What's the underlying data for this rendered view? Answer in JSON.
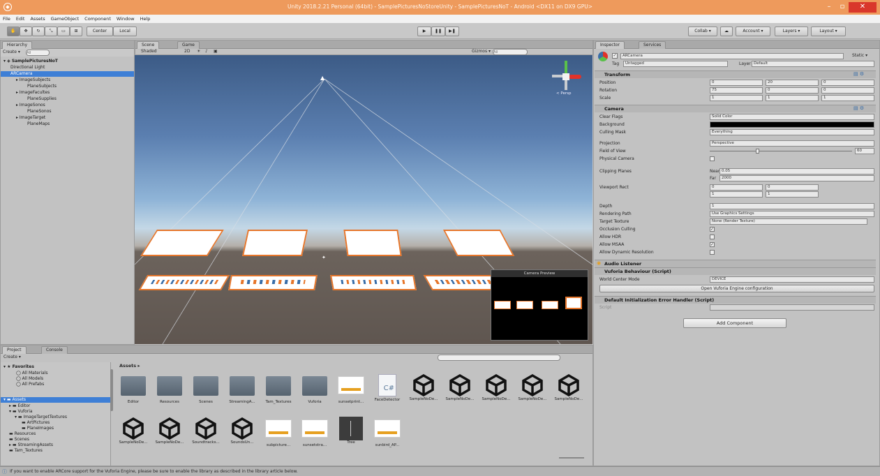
{
  "window": {
    "title": "Unity 2018.2.21 Personal (64bit) - SamplePicturesNoStoreUnity - SamplePicturesNoT - Android <DX11 on DX9 GPU>"
  },
  "menu": [
    "File",
    "Edit",
    "Assets",
    "GameObject",
    "Component",
    "Window",
    "Help"
  ],
  "toolbar": {
    "pivot": "Center",
    "space": "Local",
    "collab": "Collab ▾",
    "account": "Account ▾",
    "layers": "Layers ▾",
    "layout": "Layout ▾"
  },
  "hierarchy": {
    "tab": "Hierarchy",
    "create": "Create ▾",
    "search_placeholder": "All",
    "scene_name": "SamplePicturesNoT",
    "items": [
      "Directional Light",
      "ARCamera",
      "ImageSubjects",
      "PlaneSubjects",
      "ImageFacultes",
      "PlaneSupplies",
      "ImageSonos",
      "PlaneSonos",
      "ImageTarget",
      "PlaneMaps"
    ]
  },
  "scene": {
    "tabs": [
      "Scene",
      "Game"
    ],
    "shading": "Shaded",
    "mode2d": "2D",
    "gizmos": "Gizmos ▾",
    "search_placeholder": "All",
    "persp": "< Persp",
    "preview_title": "Camera Preview"
  },
  "inspector": {
    "tabs": [
      "Inspector",
      "Services"
    ],
    "object_name": "ARCamera",
    "static": "Static ▾",
    "tag_label": "Tag",
    "tag_value": "Untagged",
    "layer_label": "Layer",
    "layer_value": "Default",
    "transform": {
      "title": "Transform",
      "rows": [
        {
          "label": "Position",
          "x": "0",
          "y": "20",
          "z": "0"
        },
        {
          "label": "Rotation",
          "x": "75",
          "y": "0",
          "z": "0"
        },
        {
          "label": "Scale",
          "x": "1",
          "y": "1",
          "z": "1"
        }
      ]
    },
    "camera": {
      "title": "Camera",
      "clear_flags_label": "Clear Flags",
      "clear_flags": "Solid Color",
      "background_label": "Background",
      "culling_label": "Culling Mask",
      "culling": "Everything",
      "projection_label": "Projection",
      "projection": "Perspective",
      "fov_label": "Field of View",
      "fov": "60",
      "fov_fraction": 0.33,
      "physical_label": "Physical Camera",
      "clipping_label": "Clipping Planes",
      "near_label": "Near",
      "near": "0.05",
      "far_label": "Far",
      "far": "2000",
      "viewport_label": "Viewport Rect",
      "vx": "0",
      "vy": "0",
      "vw": "1",
      "vh": "1",
      "depth_label": "Depth",
      "depth": "1",
      "rendering_label": "Rendering Path",
      "rendering": "Use Graphics Settings",
      "target_label": "Target Texture",
      "target": "None (Render Texture)",
      "occlusion_label": "Occlusion Culling",
      "hdr_label": "Allow HDR",
      "msaa_label": "Allow MSAA",
      "dynres_label": "Allow Dynamic Resolution"
    },
    "audio_listener": "Audio Listener",
    "vuforia": {
      "title": "Vuforia Behaviour (Script)",
      "world_center_label": "World Center Mode",
      "world_center": "DEVICE",
      "open_config": "Open Vuforia Engine configuration"
    },
    "error_handler": {
      "title": "Default Initialization Error Handler (Script)",
      "script_label": "Script"
    },
    "add_component": "Add Component"
  },
  "project": {
    "tabs": [
      "Project",
      "Console"
    ],
    "create": "Create ▾",
    "favorites": "Favorites",
    "fav_items": [
      "All Materials",
      "All Models",
      "All Prefabs"
    ],
    "assets_root": "Assets",
    "tree": [
      "Editor",
      "Vuforia",
      "ImageTargetTextures",
      "ArtPictures",
      "PlaneImages",
      "Resources",
      "Scenes",
      "StreamingAssets",
      "Tam_Textures"
    ],
    "breadcrumb": "Assets ▸",
    "assets": [
      {
        "name": "Editor",
        "kind": "folder"
      },
      {
        "name": "Resources",
        "kind": "folder"
      },
      {
        "name": "Scenes",
        "kind": "folder"
      },
      {
        "name": "StreamingA...",
        "kind": "folder"
      },
      {
        "name": "Tam_Textures",
        "kind": "folder"
      },
      {
        "name": "Vuforia",
        "kind": "folder"
      },
      {
        "name": "sunsetprint...",
        "kind": "image"
      },
      {
        "name": "FaceDetector",
        "kind": "script"
      },
      {
        "name": "SampleNoDe...",
        "kind": "unity"
      },
      {
        "name": "SampleNoDe...",
        "kind": "unity"
      },
      {
        "name": "SampleNoDe...",
        "kind": "unity"
      },
      {
        "name": "SampleNoDe...",
        "kind": "unity"
      },
      {
        "name": "SampleNoDe...",
        "kind": "unity"
      },
      {
        "name": "SampleNoDe...",
        "kind": "unity"
      },
      {
        "name": "SampleNoDe...",
        "kind": "unity"
      },
      {
        "name": "Soundtracks...",
        "kind": "unity"
      },
      {
        "name": "SoundsUn...",
        "kind": "unity"
      },
      {
        "name": "subpicture...",
        "kind": "image"
      },
      {
        "name": "sunsetstra...",
        "kind": "image"
      },
      {
        "name": "Tree",
        "kind": "texture"
      },
      {
        "name": "sunbird_AP...",
        "kind": "image"
      }
    ]
  },
  "status": {
    "message": "If you want to enable ARCore support for the Vuforia Engine, please be sure to enable the library as described in the library article below."
  },
  "colors": {
    "accent": "#ee9a5c",
    "selection": "#3e7fd6",
    "card_border": "#e6762b"
  }
}
